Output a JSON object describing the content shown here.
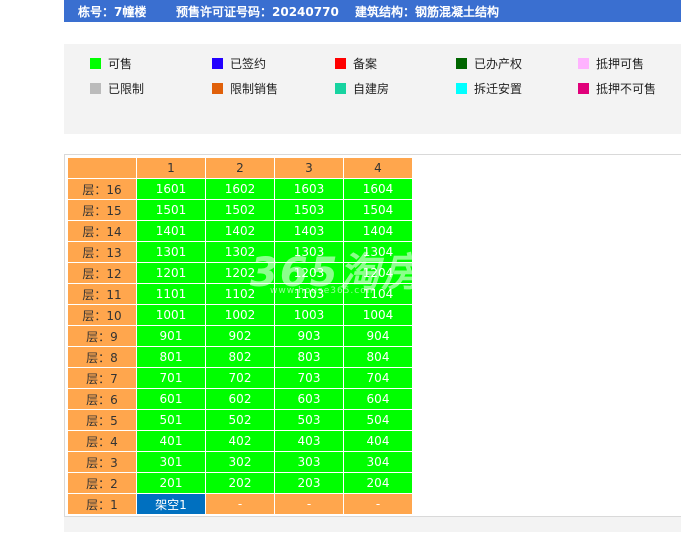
{
  "header": {
    "building": "栋号：7幢楼",
    "permit": "预售许可证号码：20240770",
    "structure": "建筑结构：钢筋混凝土结构"
  },
  "legend": [
    {
      "label": "可售",
      "color": "#00ff00"
    },
    {
      "label": "已签约",
      "color": "#2200ff"
    },
    {
      "label": "备案",
      "color": "#ff0000"
    },
    {
      "label": "已办产权",
      "color": "#006600"
    },
    {
      "label": "抵押可售",
      "color": "#ffb3ff"
    },
    {
      "label": "已限制",
      "color": "#bbbbbb"
    },
    {
      "label": "限制销售",
      "color": "#e0600a"
    },
    {
      "label": "自建房",
      "color": "#17d3a0"
    },
    {
      "label": "拆迁安置",
      "color": "#00ffff"
    },
    {
      "label": "抵押不可售",
      "color": "#e0007a"
    }
  ],
  "table": {
    "columns": [
      "",
      "1",
      "2",
      "3",
      "4"
    ],
    "rows": [
      {
        "floor": "层：16",
        "units": [
          "1601",
          "1602",
          "1603",
          "1604"
        ]
      },
      {
        "floor": "层：15",
        "units": [
          "1501",
          "1502",
          "1503",
          "1504"
        ]
      },
      {
        "floor": "层：14",
        "units": [
          "1401",
          "1402",
          "1403",
          "1404"
        ]
      },
      {
        "floor": "层：13",
        "units": [
          "1301",
          "1302",
          "1303",
          "1304"
        ]
      },
      {
        "floor": "层：12",
        "units": [
          "1201",
          "1202",
          "1203",
          "1204"
        ]
      },
      {
        "floor": "层：11",
        "units": [
          "1101",
          "1102",
          "1103",
          "1104"
        ]
      },
      {
        "floor": "层：10",
        "units": [
          "1001",
          "1002",
          "1003",
          "1004"
        ]
      },
      {
        "floor": "层：9",
        "units": [
          "901",
          "902",
          "903",
          "904"
        ]
      },
      {
        "floor": "层：8",
        "units": [
          "801",
          "802",
          "803",
          "804"
        ]
      },
      {
        "floor": "层：7",
        "units": [
          "701",
          "702",
          "703",
          "704"
        ]
      },
      {
        "floor": "层：6",
        "units": [
          "601",
          "602",
          "603",
          "604"
        ]
      },
      {
        "floor": "层：5",
        "units": [
          "501",
          "502",
          "503",
          "504"
        ]
      },
      {
        "floor": "层：4",
        "units": [
          "401",
          "402",
          "403",
          "404"
        ]
      },
      {
        "floor": "层：3",
        "units": [
          "301",
          "302",
          "303",
          "304"
        ]
      },
      {
        "floor": "层：2",
        "units": [
          "201",
          "202",
          "203",
          "204"
        ]
      },
      {
        "floor": "层：1",
        "units": [
          "架空1",
          "-",
          "-",
          "-"
        ]
      }
    ]
  },
  "watermark": {
    "logo": "365淘房",
    "url": "www.house365.com"
  }
}
